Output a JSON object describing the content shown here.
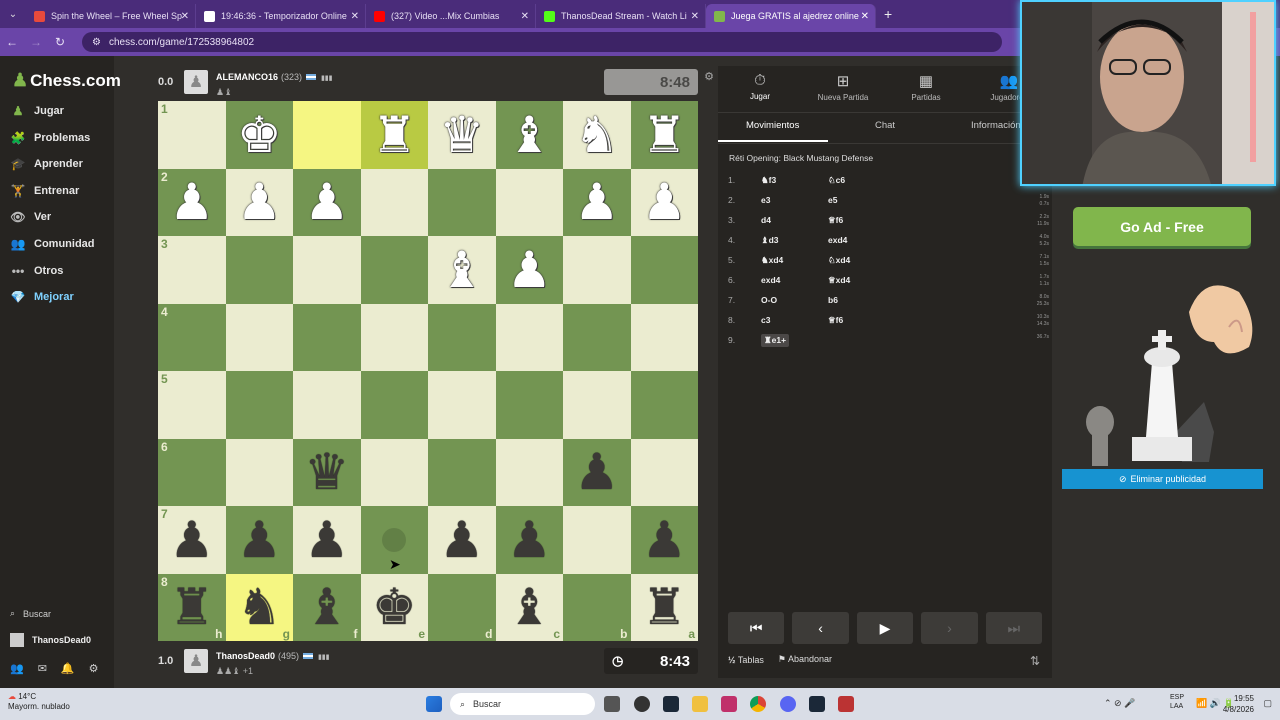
{
  "browser": {
    "tabs": [
      {
        "title": "Spin the Wheel – Free Wheel Sp",
        "color": "#e84a3c"
      },
      {
        "title": "19:46:36 - Temporizador Online",
        "color": "#ffffff"
      },
      {
        "title": "(327) Video ...Mix Cumbias",
        "color": "#ff0000"
      },
      {
        "title": "ThanosDead Stream - Watch Li",
        "color": "#53fc18"
      },
      {
        "title": "Juega GRATIS al ajedrez online",
        "color": "#81b64c"
      }
    ],
    "url": "chess.com/game/172538964802"
  },
  "sidebar": {
    "logo": "Chess.com",
    "items": [
      {
        "label": "Jugar",
        "icon": "play-icon"
      },
      {
        "label": "Problemas",
        "icon": "puzzle-icon"
      },
      {
        "label": "Aprender",
        "icon": "learn-icon"
      },
      {
        "label": "Entrenar",
        "icon": "train-icon"
      },
      {
        "label": "Ver",
        "icon": "watch-icon"
      },
      {
        "label": "Comunidad",
        "icon": "community-icon"
      },
      {
        "label": "Otros",
        "icon": "more-icon"
      },
      {
        "label": "Mejorar",
        "icon": "diamond-icon"
      }
    ],
    "search": "Buscar",
    "user": "ThanosDead0"
  },
  "top_player": {
    "score": "0.0",
    "name": "ALEMANCO16",
    "rating": "(323)",
    "clock": "8:48"
  },
  "bottom_player": {
    "score": "1.0",
    "name": "ThanosDead0",
    "rating": "(495)",
    "captured": "+1",
    "clock": "8:43"
  },
  "board": {
    "files": [
      "h",
      "g",
      "f",
      "e",
      "d",
      "c",
      "b",
      "a"
    ],
    "ranks": [
      "1",
      "2",
      "3",
      "4",
      "5",
      "6",
      "7",
      "8"
    ],
    "rows": [
      [
        "",
        "wK",
        "",
        "wR",
        "wQ",
        "wB",
        "wN",
        "wR"
      ],
      [
        "wP",
        "wP",
        "wP",
        "",
        "",
        "",
        "wP",
        "wP"
      ],
      [
        "",
        "",
        "",
        "",
        "wB",
        "wP",
        "",
        ""
      ],
      [
        "",
        "",
        "",
        "",
        "",
        "",
        "",
        ""
      ],
      [
        "",
        "",
        "",
        "",
        "",
        "",
        "",
        ""
      ],
      [
        "",
        "",
        "bQ",
        "",
        "",
        "",
        "bP",
        ""
      ],
      [
        "bP",
        "bP",
        "bP",
        "",
        "bP",
        "bP",
        "",
        "bP"
      ],
      [
        "bR",
        "bN",
        "bB",
        "bK",
        "",
        "bB",
        "",
        "bR"
      ]
    ],
    "highlights": [
      "0,2",
      "0,3",
      "7,1"
    ]
  },
  "right_panel": {
    "tabs": [
      {
        "label": "Jugar",
        "icon": "stopwatch-icon"
      },
      {
        "label": "Nueva Partida",
        "icon": "plus-icon"
      },
      {
        "label": "Partidas",
        "icon": "board-icon"
      },
      {
        "label": "Jugadores",
        "icon": "players-icon"
      }
    ],
    "subtabs": [
      "Movimientos",
      "Chat",
      "Información"
    ],
    "opening": "Réti Opening: Black Mustang Defense",
    "moves": [
      {
        "n": "1.",
        "w": "♞f3",
        "b": "♘c6",
        "t": [
          "",
          ""
        ]
      },
      {
        "n": "2.",
        "w": "e3",
        "b": "e5",
        "t": [
          "1.9s",
          "0.7s"
        ]
      },
      {
        "n": "3.",
        "w": "d4",
        "b": "♕f6",
        "t": [
          "2.2s",
          "11.9s"
        ]
      },
      {
        "n": "4.",
        "w": "♝d3",
        "b": "exd4",
        "t": [
          "4.0s",
          "5.2s"
        ]
      },
      {
        "n": "5.",
        "w": "♞xd4",
        "b": "♘xd4",
        "t": [
          "7.1s",
          "1.5s"
        ]
      },
      {
        "n": "6.",
        "w": "exd4",
        "b": "♕xd4",
        "t": [
          "1.7s",
          "1.1s"
        ]
      },
      {
        "n": "7.",
        "w": "O-O",
        "b": "b6",
        "t": [
          "8.0s",
          "25.3s"
        ]
      },
      {
        "n": "8.",
        "w": "c3",
        "b": "♕f6",
        "t": [
          "10.3s",
          "14.3s"
        ]
      },
      {
        "n": "9.",
        "w": "♜e1+",
        "b": "",
        "t": [
          "36.7s",
          ""
        ]
      }
    ],
    "tablas": "Tablas",
    "abandonar": "Abandonar"
  },
  "ad": {
    "button": "Go Ad - Free",
    "remove": "Eliminar publicidad"
  },
  "taskbar": {
    "temp": "14°C",
    "weather": "Mayorm. nublado",
    "search": "Buscar",
    "lang1": "ESP",
    "lang2": "LAA",
    "time": "19:55",
    "date": "4/8/2026"
  }
}
